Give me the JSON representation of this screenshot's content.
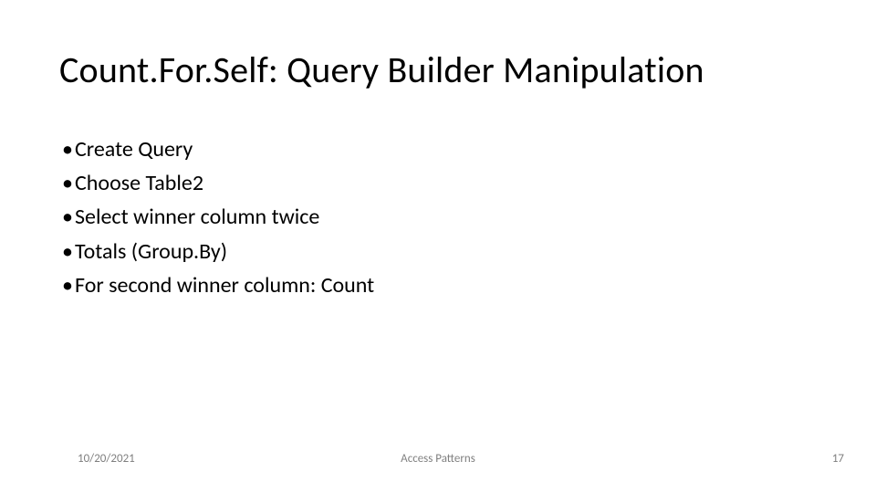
{
  "slide": {
    "title": "Count.For.Self: Query Builder Manipulation",
    "bullets": [
      "Create Query",
      "Choose Table2",
      "Select winner column twice",
      "Totals (Group.By)",
      "For second winner column: Count"
    ],
    "footer": {
      "date": "10/20/2021",
      "center": "Access Patterns",
      "page": "17"
    }
  }
}
